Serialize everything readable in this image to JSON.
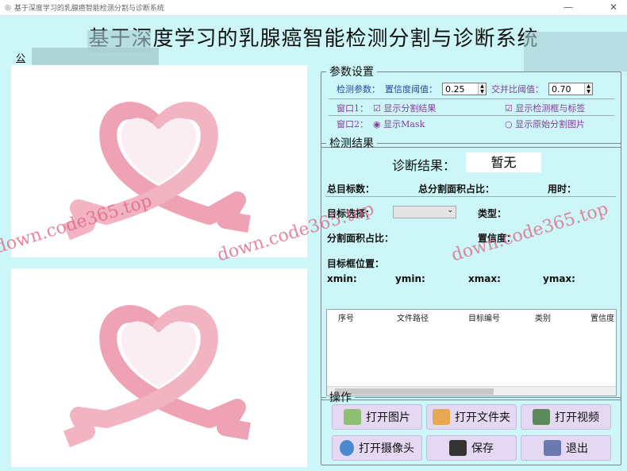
{
  "window": {
    "title": "基于深度学习的乳腺癌智能检测分割与诊断系统",
    "minimize": "—",
    "close": "✕"
  },
  "header": {
    "title": "基于深度学习的乳腺癌智能检测分割与诊断系统",
    "author_prefix": "公"
  },
  "params": {
    "legend": "参数设置",
    "detect_label": "检测参数：",
    "conf_label": "置信度阈值：",
    "conf_value": "0.25",
    "iou_label": "交并比阈值：",
    "iou_value": "0.70",
    "win1_label": "窗口1：",
    "show_seg": "显示分割结果",
    "show_box": "显示检测框与标签",
    "win2_label": "窗口2：",
    "show_mask": "显示Mask",
    "show_orig": "显示原始分割图片"
  },
  "results": {
    "legend": "检测结果",
    "diag_label": "诊断结果：",
    "diag_value": "暂无",
    "total_targets": "总目标数：",
    "total_area": "总分割面积占比：",
    "time": "用时：",
    "target_select": "目标选择：",
    "type": "类型：",
    "seg_area": "分割面积占比：",
    "confidence": "置信度：",
    "box_pos": "目标框位置：",
    "xmin": "xmin:",
    "ymin": "ymin:",
    "xmax": "xmax:",
    "ymax": "ymax:"
  },
  "table": {
    "columns": [
      "序号",
      "文件路径",
      "目标编号",
      "类别",
      "置信度"
    ]
  },
  "ops": {
    "legend": "操作",
    "open_image": "打开图片",
    "open_folder": "打开文件夹",
    "open_video": "打开视频",
    "open_camera": "打开摄像头",
    "save": "保存",
    "exit": "退出"
  },
  "watermarks": [
    "down.code365.top",
    "down.code365.top",
    "down.code365.top"
  ]
}
